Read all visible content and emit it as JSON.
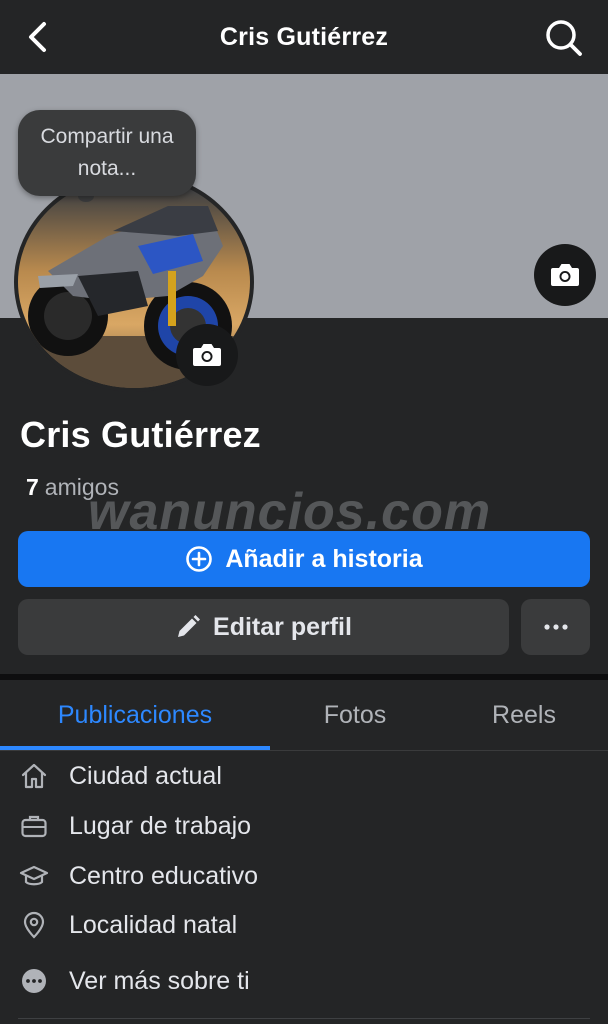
{
  "header": {
    "title": "Cris Gutiérrez",
    "back_icon": "chevron-left-icon",
    "search_icon": "search-icon"
  },
  "note": {
    "text": "Compartir una nota..."
  },
  "profile": {
    "name": "Cris Gutiérrez",
    "friends_count": "7",
    "friends_label": "amigos"
  },
  "watermark": "wanuncios.com",
  "actions": {
    "add_story_label": "Añadir a historia",
    "edit_profile_label": "Editar perfil",
    "more_label": "···"
  },
  "tabs": [
    {
      "label": "Publicaciones",
      "active": true
    },
    {
      "label": "Fotos",
      "active": false
    },
    {
      "label": "Reels",
      "active": false
    }
  ],
  "details": [
    {
      "label": "Ciudad actual",
      "icon": "home-icon"
    },
    {
      "label": "Lugar de trabajo",
      "icon": "briefcase-icon"
    },
    {
      "label": "Centro educativo",
      "icon": "graduation-cap-icon"
    },
    {
      "label": "Localidad natal",
      "icon": "location-pin-icon"
    },
    {
      "label": "Ver más sobre ti",
      "icon": "more-dots-icon"
    }
  ],
  "colors": {
    "background": "#242526",
    "accent": "#1877f2",
    "tab_active": "#2d88ff",
    "cover": "#9fa2a8"
  }
}
